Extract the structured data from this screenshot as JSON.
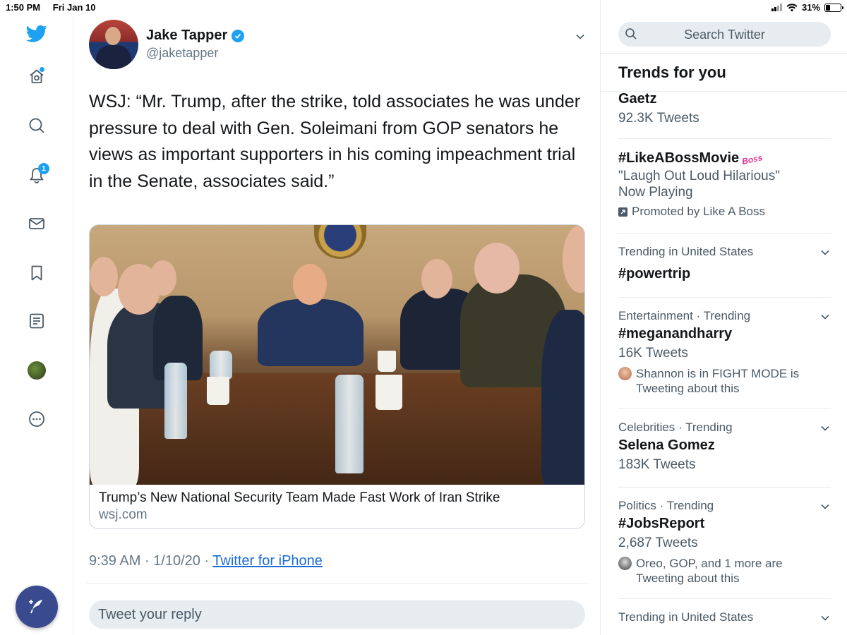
{
  "status_bar": {
    "time": "1:50 PM",
    "date": "Fri Jan 10",
    "battery": "31%",
    "battery_level": 0.31
  },
  "nav": {
    "items": [
      "twitter-logo",
      "home-icon",
      "explore-icon",
      "notifications-icon",
      "messages-icon",
      "bookmarks-icon",
      "lists-icon",
      "profile-avatar",
      "more-icon"
    ],
    "notifications_badge": "1",
    "compose_icon": "compose-tweet-icon"
  },
  "tweet": {
    "author_name": "Jake Tapper",
    "author_handle": "@jaketapper",
    "text": "WSJ: “Mr. Trump, after the strike, told associates he was under pressure to deal with Gen. Soleimani from GOP senators he views as important supporters in his coming impeachment trial in the Senate, associates said.”",
    "card": {
      "title": "Trump’s New National Security Team Made Fast Work of Iran Strike",
      "domain": "wsj.com"
    },
    "time": "9:39 AM · 1/10/20 · ",
    "source": "Twitter for iPhone",
    "reply_placeholder": "Tweet your reply"
  },
  "sidebar": {
    "search_placeholder": "Search Twitter",
    "trends_title": "Trends for you",
    "trends": [
      {
        "name": "Gaetz",
        "count": "92.3K Tweets"
      },
      {
        "name": "#LikeABossMovie",
        "desc1": "\"Laugh Out Loud Hilarious\"",
        "desc2": "Now Playing",
        "promo": "Promoted by Like A Boss"
      },
      {
        "meta": "Trending in United States",
        "name": "#powertrip"
      },
      {
        "meta": "Entertainment · Trending",
        "name": "#meganandharry",
        "count": "16K Tweets",
        "social1": "Shannon is in FIGHT MODE is",
        "social2": "Tweeting about this"
      },
      {
        "meta": "Celebrities · Trending",
        "name": "Selena Gomez",
        "count": "183K Tweets"
      },
      {
        "meta": "Politics · Trending",
        "name": "#JobsReport",
        "count": "2,687 Tweets",
        "social1": "Oreo, GOP, and 1 more are",
        "social2": "Tweeting about this"
      },
      {
        "meta": "Trending in United States"
      }
    ]
  },
  "colors": {
    "accent": "#1da1f2",
    "compose": "#3a4a8f",
    "link": "#1b6bd6",
    "muted": "#657786"
  }
}
